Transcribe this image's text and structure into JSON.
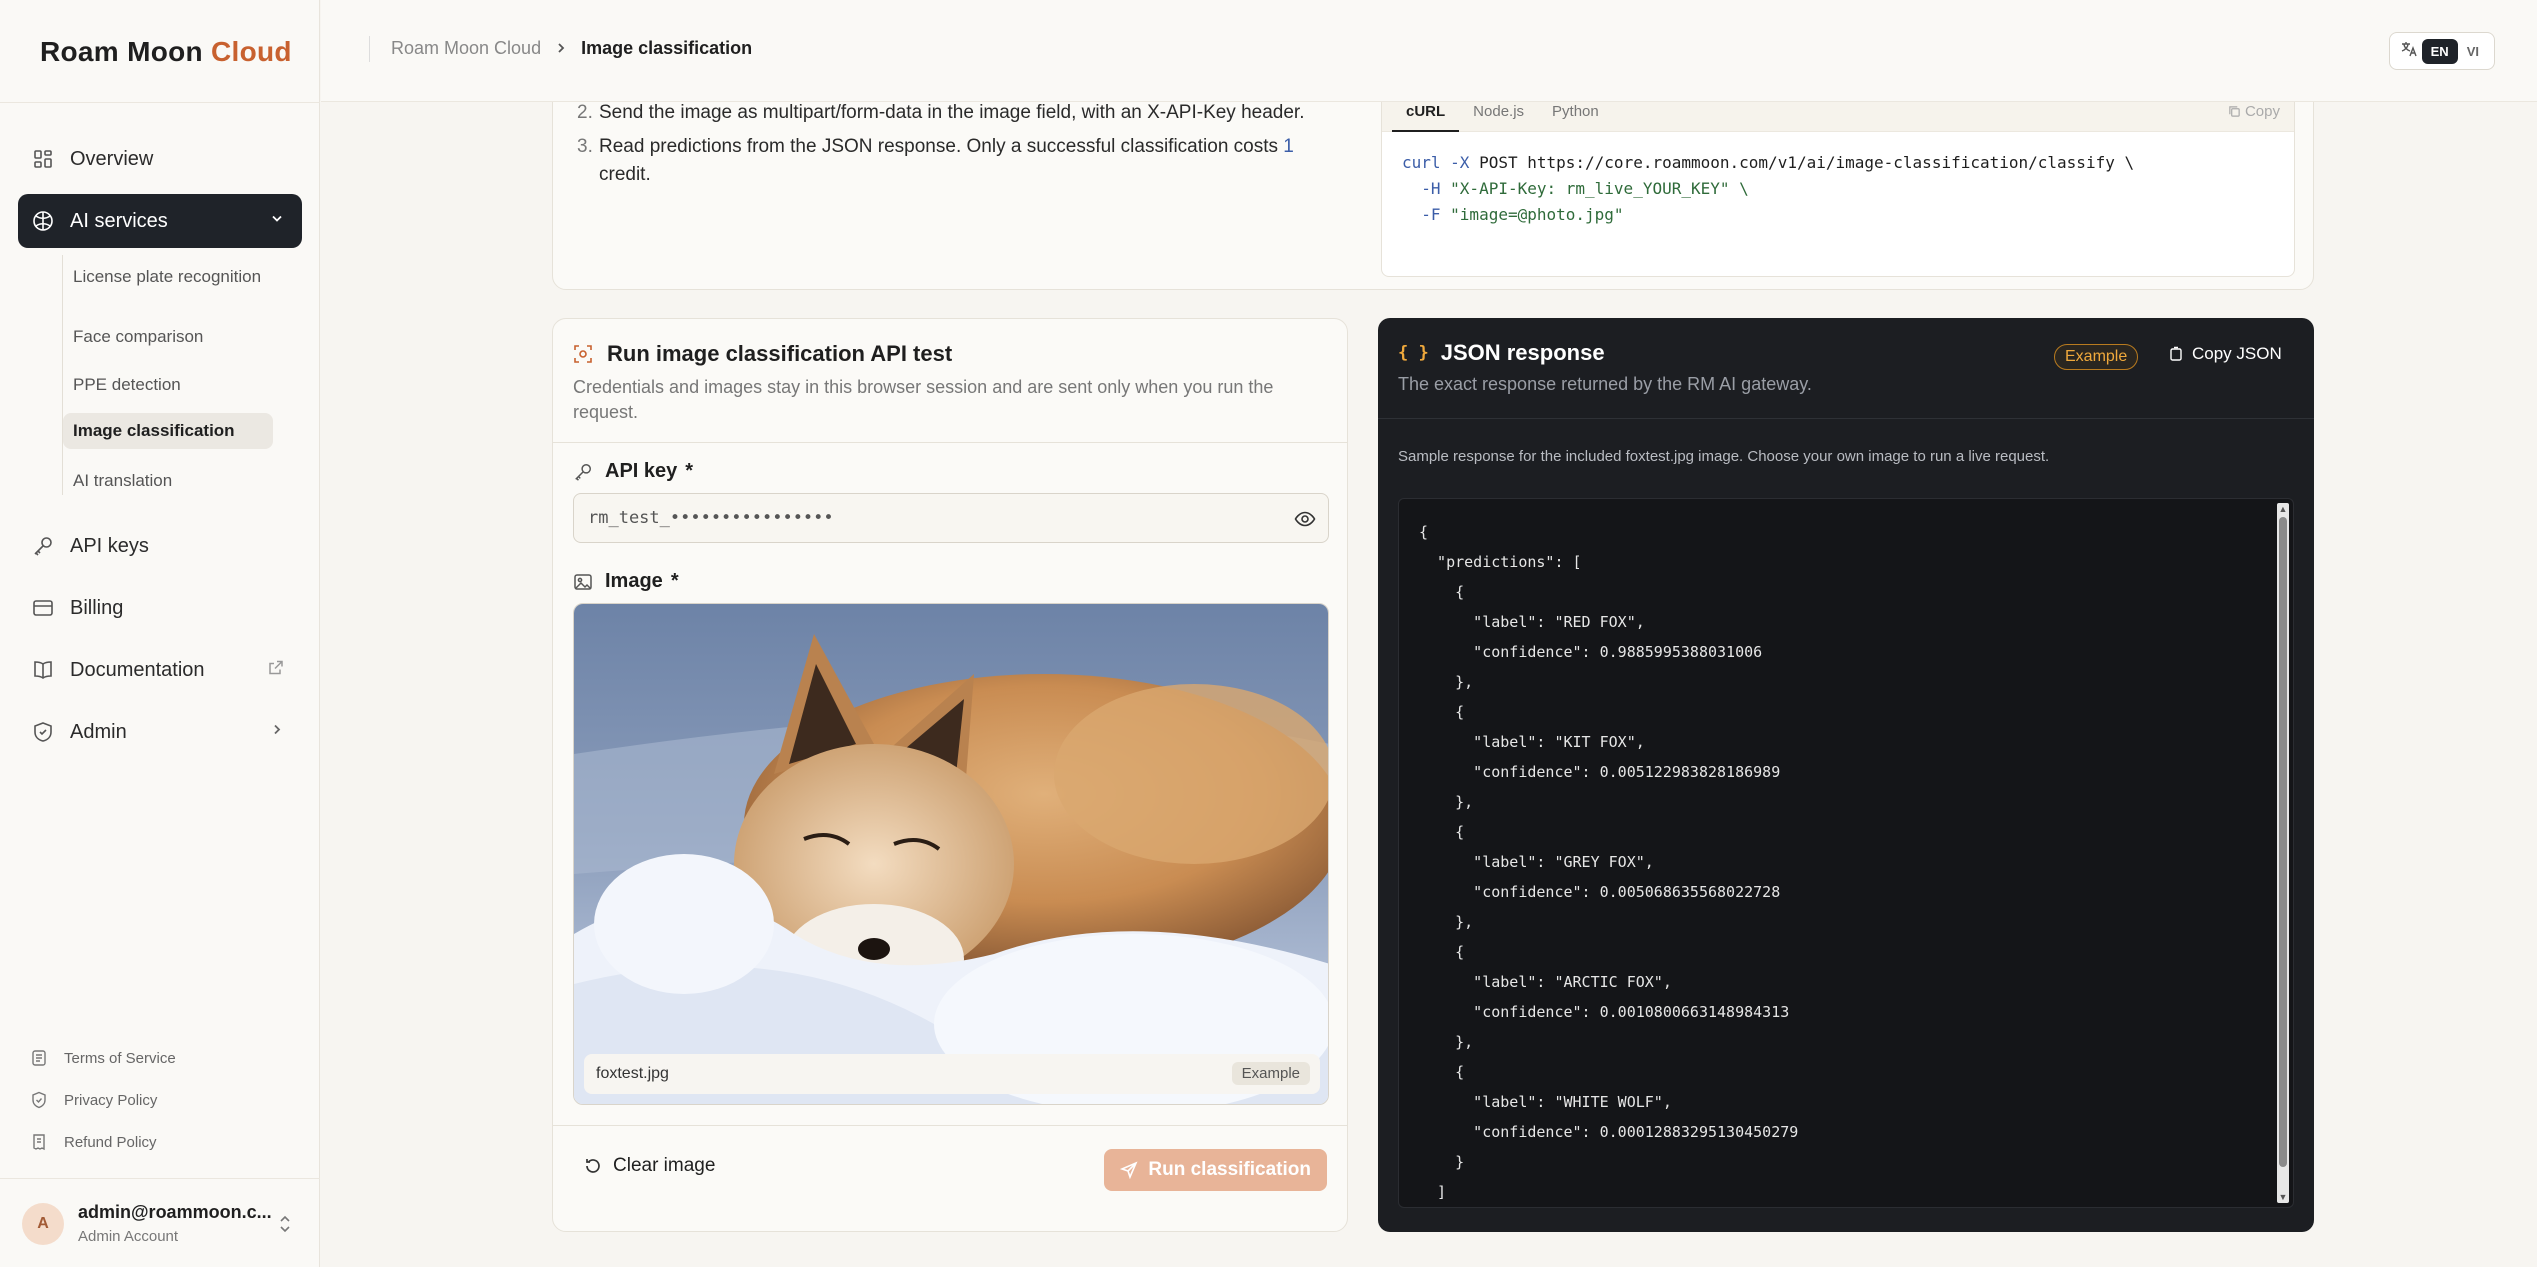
{
  "brand": {
    "name_main": "Roam Moon",
    "name_accent": "Cloud"
  },
  "sidebar": {
    "items": [
      {
        "label": "Overview",
        "icon": "grid-icon"
      },
      {
        "label": "AI services",
        "icon": "ai-icon",
        "active": true
      },
      {
        "label": "API keys",
        "icon": "key-icon"
      },
      {
        "label": "Billing",
        "icon": "card-icon"
      },
      {
        "label": "Documentation",
        "icon": "book-icon"
      },
      {
        "label": "Admin",
        "icon": "shield-icon"
      }
    ],
    "sub_items": [
      {
        "label": "License plate recognition"
      },
      {
        "label": "Face comparison"
      },
      {
        "label": "PPE detection"
      },
      {
        "label": "Image classification",
        "active": true
      },
      {
        "label": "AI translation"
      }
    ],
    "footer_links": [
      {
        "label": "Terms of Service"
      },
      {
        "label": "Privacy Policy"
      },
      {
        "label": "Refund Policy"
      }
    ],
    "user": {
      "initial": "A",
      "email": "admin@roammoon.c...",
      "role": "Admin Account"
    }
  },
  "breadcrumb": {
    "root": "Roam Moon Cloud",
    "current": "Image classification"
  },
  "language": {
    "options": [
      "EN",
      "VI"
    ],
    "selected": "EN"
  },
  "docs": {
    "steps": [
      {
        "num": "2.",
        "text": "Send the image as multipart/form-data in the image field, with an X-API-Key header."
      },
      {
        "num": "3.",
        "text_before": "Read predictions from the JSON response. Only a successful classification costs ",
        "highlight": "1",
        "text_after": " credit."
      }
    ],
    "code_tabs": [
      "cURL",
      "Node.js",
      "Python"
    ],
    "code_tab_selected": "cURL",
    "copy_label": "Copy",
    "code_lines": [
      {
        "cmd": "curl",
        "flag": "-X",
        "rest": " POST https://core.roammoon.com/v1/ai/image-classification/classify \\"
      },
      {
        "cmd": "",
        "flag": "-H",
        "rest": " \"X-API-Key: rm_live_YOUR_KEY\" \\"
      },
      {
        "cmd": "",
        "flag": "-F",
        "rest": " \"image=@photo.jpg\""
      }
    ]
  },
  "test": {
    "title": "Run image classification API test",
    "description": "Credentials and images stay in this browser session and are sent only when you run the request.",
    "api_key_label": "API key",
    "required_mark": "*",
    "api_key_value": "rm_test_••••••••••••••••",
    "image_label": "Image",
    "image_filename": "foxtest.jpg",
    "image_tag": "Example",
    "clear_label": "Clear image",
    "run_label": "Run classification"
  },
  "response": {
    "title": "JSON response",
    "subtitle": "The exact response returned by the RM AI gateway.",
    "badge": "Example",
    "copy_label": "Copy JSON",
    "note": "Sample response for the included foxtest.jpg image. Choose your own image to run a live request.",
    "predictions": [
      {
        "label": "RED FOX",
        "confidence": "0.9885995388031006"
      },
      {
        "label": "KIT FOX",
        "confidence": "0.005122983828186989"
      },
      {
        "label": "GREY FOX",
        "confidence": "0.005068635568022728"
      },
      {
        "label": "ARCTIC FOX",
        "confidence": "0.0010800663148984313"
      },
      {
        "label": "WHITE WOLF",
        "confidence": "0.00012883295130450279"
      }
    ]
  }
}
